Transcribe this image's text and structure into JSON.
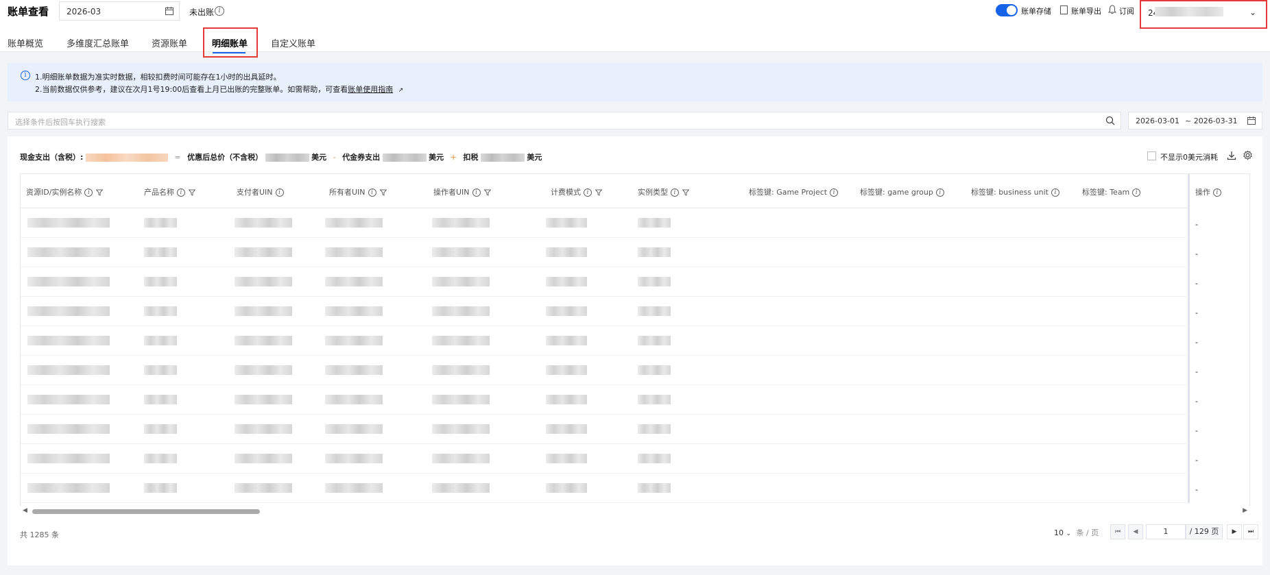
{
  "header": {
    "title": "账单查看",
    "month_value": "2026-03",
    "unbilled_label": "未出账",
    "storage_label": "账单存储",
    "export_label": "账单导出",
    "subscribe_label": "订阅",
    "account_prefix": "24"
  },
  "tabs": [
    {
      "label": "账单概览"
    },
    {
      "label": "多维度汇总账单"
    },
    {
      "label": "资源账单"
    },
    {
      "label": "明细账单",
      "active": true
    },
    {
      "label": "自定义账单"
    }
  ],
  "notice": {
    "line1": "1.明细账单数据为准实时数据，相较扣费时间可能存在1小时的出具延时。",
    "line2_prefix": "2.当前数据仅供参考，建议在次月1号19:00后查看上月已出账的完整账单。如需帮助，可查看",
    "line2_link": "账单使用指南"
  },
  "search": {
    "placeholder": "选择条件后按回车执行搜索",
    "date_start": "2026-03-01",
    "date_end": "~ 2026-03-31"
  },
  "summary": {
    "cash_label": "现金支出（含税）:",
    "eq": "=",
    "discount_label": "优惠后总价（不含税）",
    "unit1": "美元",
    "minus": "-",
    "voucher_label": "代金券支出",
    "unit2": "美元",
    "plus": "+",
    "tax_label": "扣税",
    "unit3": "美元",
    "hide_zero_label": "不显示0美元消耗"
  },
  "table": {
    "columns": [
      {
        "label": "资源ID/实例名称"
      },
      {
        "label": "产品名称"
      },
      {
        "label": "支付者UIN"
      },
      {
        "label": "所有者UIN"
      },
      {
        "label": "操作者UIN"
      },
      {
        "label": "计费模式"
      },
      {
        "label": "实例类型"
      },
      {
        "label": "标签键: Game Project"
      },
      {
        "label": "标签键: game group"
      },
      {
        "label": "标签键: business unit"
      },
      {
        "label": "标签键: Team"
      }
    ],
    "action_column": "操作",
    "rows": [
      "-",
      "-",
      "-",
      "-",
      "-",
      "-",
      "-",
      "-",
      "-",
      "-"
    ]
  },
  "footer": {
    "total": "共 1285 条",
    "page_size": "10",
    "per_page_label": "条 / 页",
    "current_page": "1",
    "total_pages": "/ 129 页"
  },
  "colors": {
    "accent": "#1763e8",
    "highlight": "#e53935",
    "notice_bg": "#e8f0fd"
  }
}
